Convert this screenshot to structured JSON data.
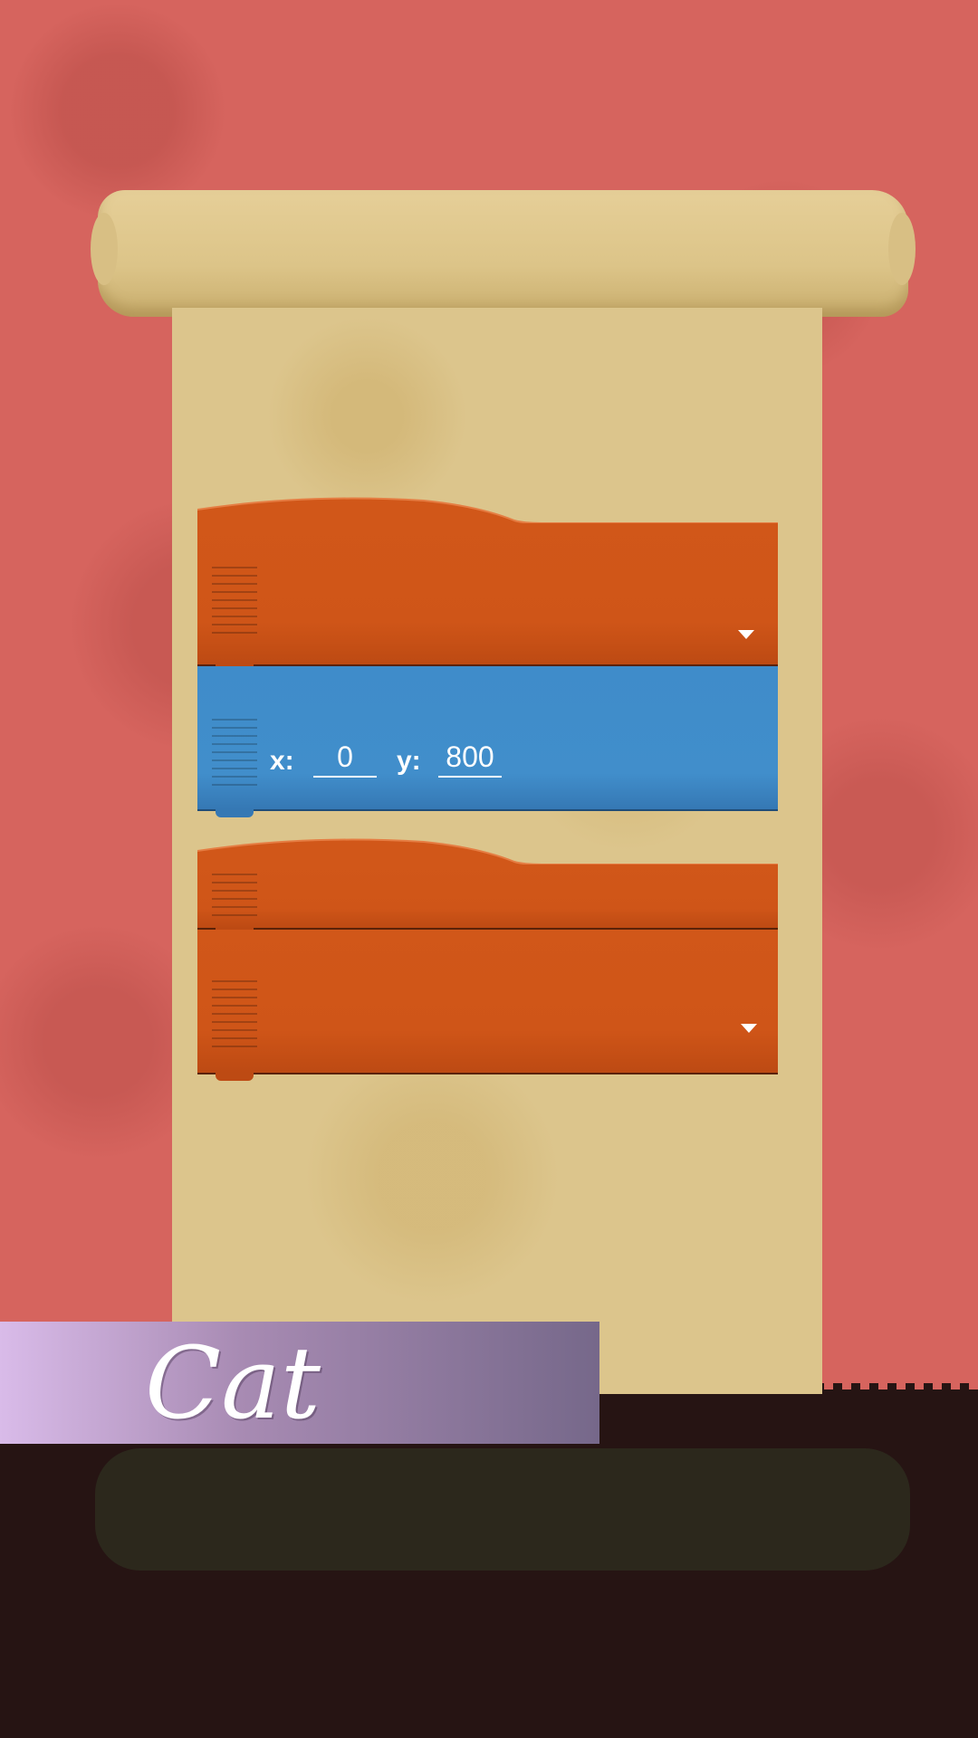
{
  "block_stack_1": {
    "hat_block": {
      "dropdown_value": ""
    },
    "motion_block": {
      "x_label": "x:",
      "x_value": "0",
      "y_label": "y:",
      "y_value": "800"
    }
  },
  "block_stack_2": {
    "hat_block": {},
    "action_block": {
      "dropdown_value": ""
    }
  },
  "sprite": {
    "name": "Cat"
  },
  "colors": {
    "background": "#d6645e",
    "scroll": "#dcc58c",
    "event_block": "#cf5518",
    "motion_block": "#418ecb",
    "ground": "#261413",
    "banner_start": "#d9bbe9",
    "banner_end": "#76688a"
  }
}
